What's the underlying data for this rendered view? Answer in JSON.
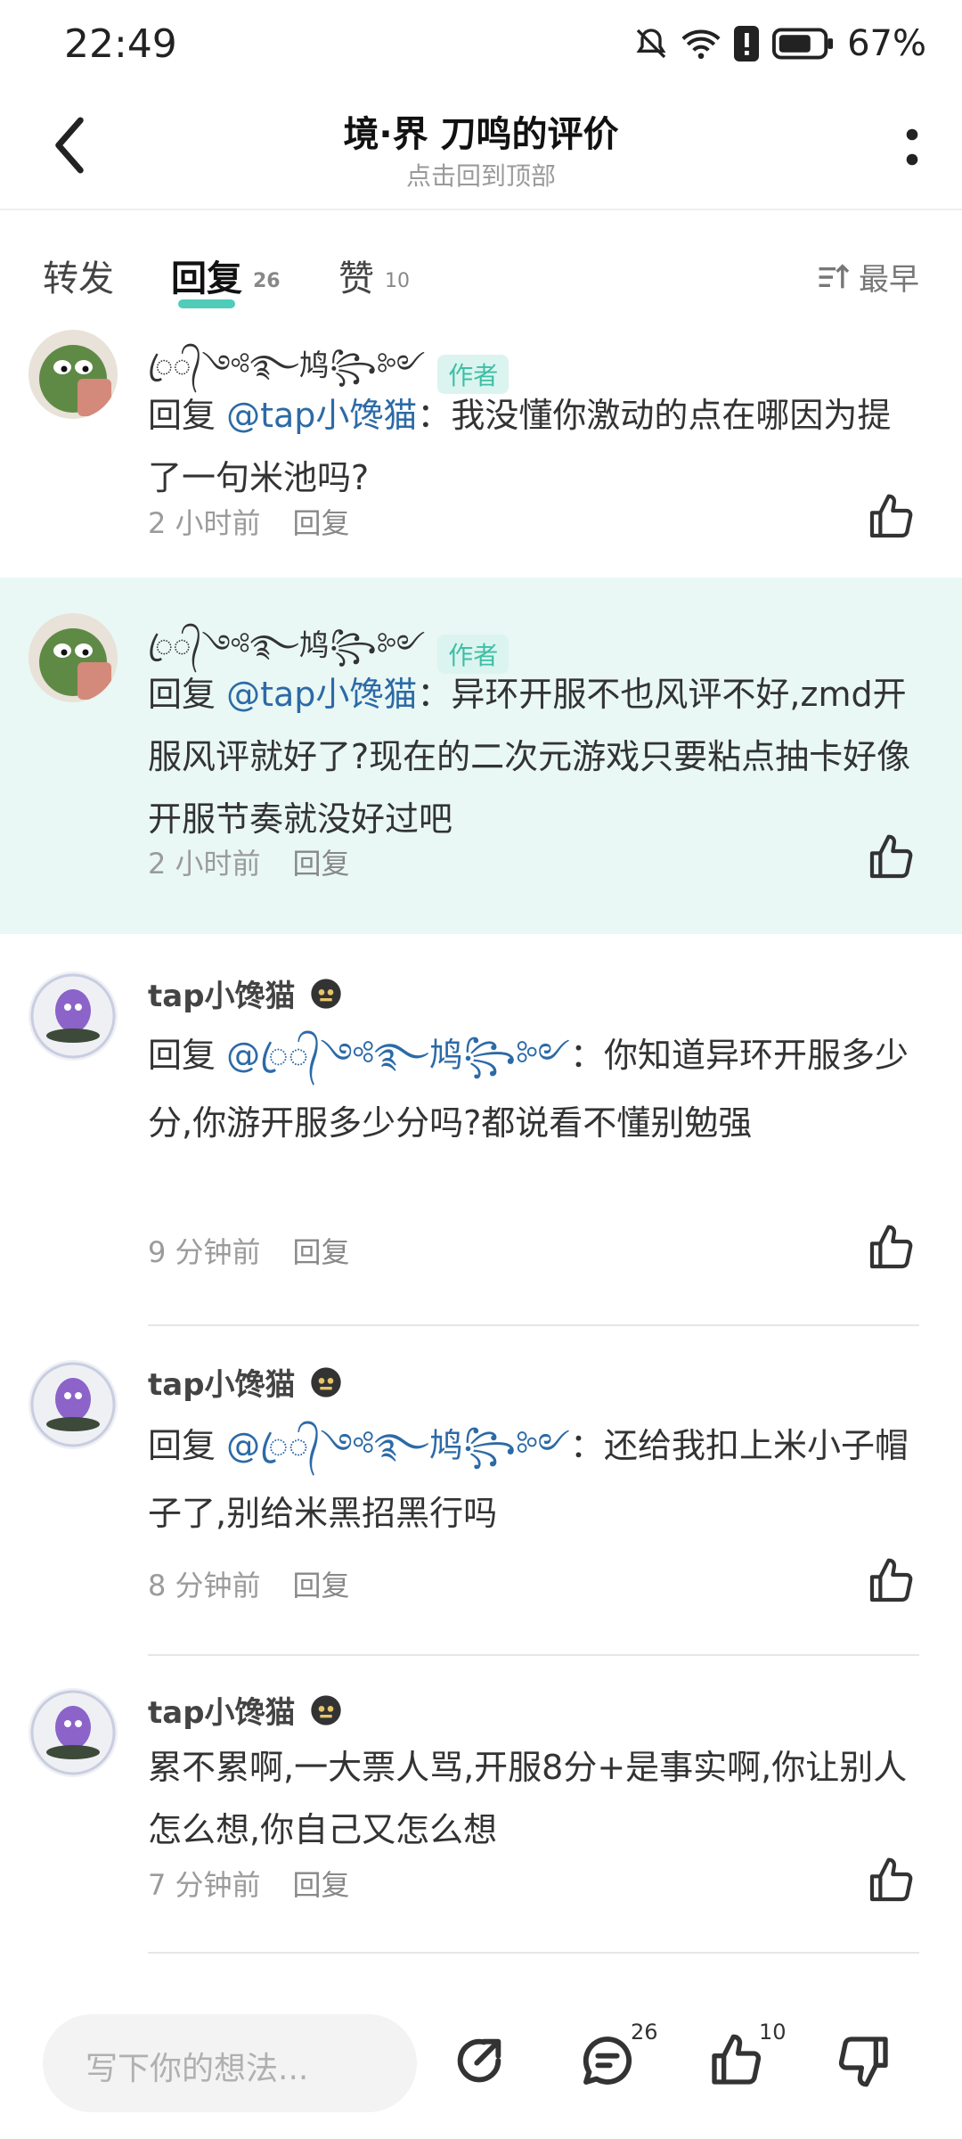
{
  "status": {
    "time": "22:49",
    "battery": "67%"
  },
  "header": {
    "title": "境·界 刀鸣的评价",
    "subtitle": "点击回到顶部"
  },
  "tabs": [
    {
      "label": "转发",
      "count": ""
    },
    {
      "label": "回复",
      "count": "26"
    },
    {
      "label": "赞",
      "count": "10"
    }
  ],
  "sort_label": "最早",
  "author_badge": "作者",
  "comments": [
    {
      "name": "ꦿ᭄༺࿐鸠꧂༻",
      "badge": "作者",
      "prefix": "回复 ",
      "mention": "@tap小馋猫",
      "colon": "：",
      "text": "我没懂你激动的点在哪因为提了一句米池吗?",
      "time": "2 小时前",
      "reply": "回复"
    },
    {
      "name": "ꦿ᭄༺࿐鸠꧂༻",
      "badge": "作者",
      "prefix": "回复 ",
      "mention": "@tap小馋猫",
      "colon": "：",
      "text": "异环开服不也风评不好,zmd开服风评就好了?现在的二次元游戏只要粘点抽卡好像开服节奏就没好过吧",
      "time": "2 小时前",
      "reply": "回复"
    },
    {
      "name": "tap小馋猫",
      "prefix": "回复 ",
      "mention": "@ꦿ᭄༺࿐鸠꧂༻",
      "colon": "：",
      "text": "你知道异环开服多少分,你游开服多少分吗?都说看不懂别勉强",
      "time": "9 分钟前",
      "reply": "回复"
    },
    {
      "name": "tap小馋猫",
      "prefix": "回复 ",
      "mention": "@ꦿ᭄༺࿐鸠꧂༻",
      "colon": "：",
      "text": "还给我扣上米小子帽子了,别给米黑招黑行吗",
      "time": "8 分钟前",
      "reply": "回复"
    },
    {
      "name": "tap小馋猫",
      "prefix": "",
      "mention": "",
      "colon": "",
      "text": "累不累啊,一大票人骂,开服8分+是事实啊,你让别人怎么想,你自己又怎么想",
      "time": "7 分钟前",
      "reply": "回复"
    }
  ],
  "bottom": {
    "placeholder": "写下你的想法...",
    "comment_count": "26",
    "like_count": "10"
  },
  "colors": {
    "accent": "#3dc7b0",
    "highlight_bg": "#e9f8f5",
    "mention": "#2c6aa6"
  }
}
